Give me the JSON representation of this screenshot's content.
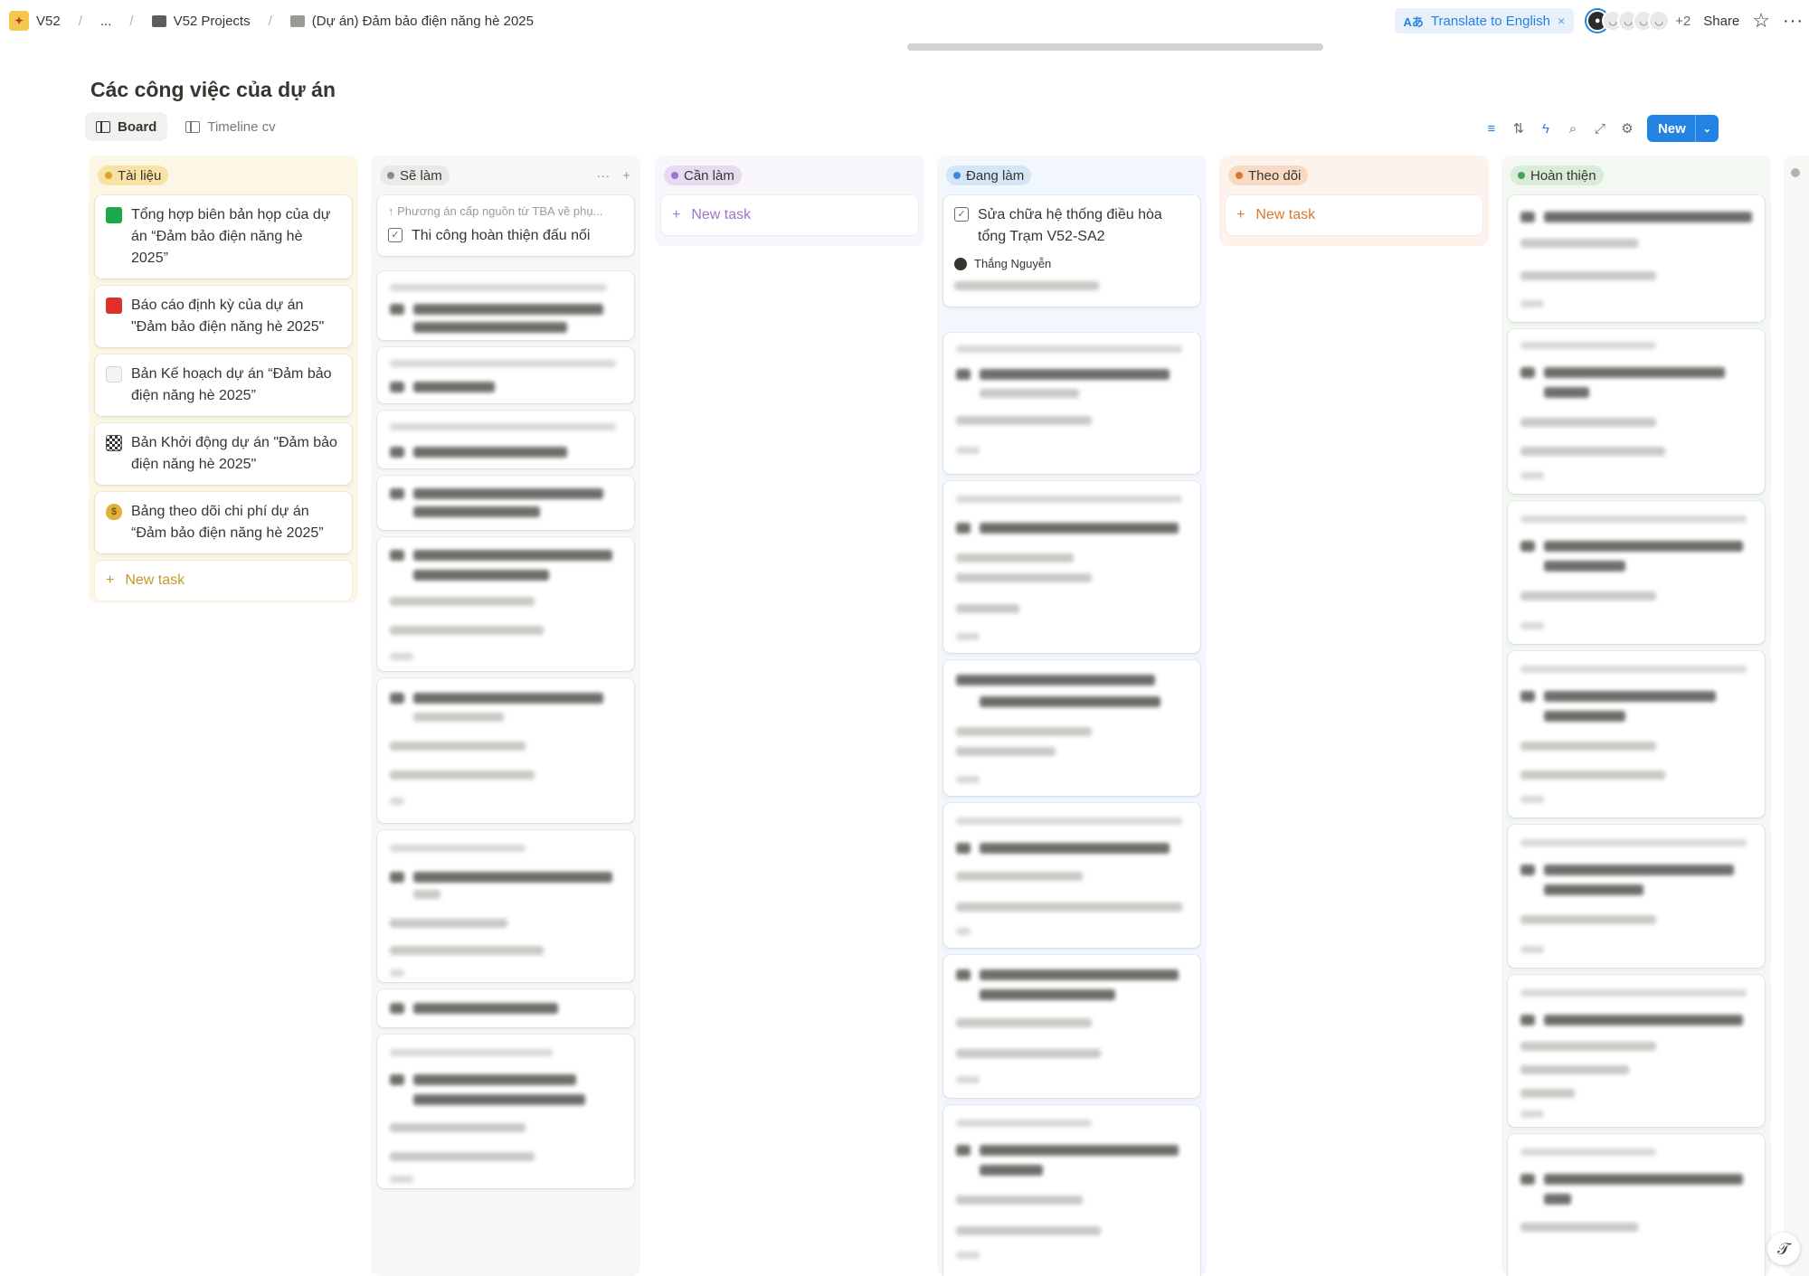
{
  "breadcrumb": {
    "workspace": "V52",
    "ellipsis": "...",
    "projects": "V52 Projects",
    "page": "(Dự án) Đảm bảo điện năng hè 2025"
  },
  "topbar": {
    "translate_label": "Translate to English",
    "translate_close": "×",
    "more_people": "+2",
    "share": "Share",
    "star": "☆",
    "more": "···"
  },
  "page": {
    "title": "Các công việc của dự án"
  },
  "tabs": [
    {
      "label": "Board"
    },
    {
      "label": "Timeline cv"
    }
  ],
  "toolbar": {
    "new_label": "New",
    "new_caret": "⌄"
  },
  "columns": {
    "tai_lieu": {
      "label": "Tài liệu",
      "color": "#fbf6e6",
      "pill_bg": "#f8e2a6",
      "dot": "#d6a52a",
      "cards": [
        {
          "icon": "green-square-icon",
          "title": "Tổng hợp biên bản họp của dự án “Đảm bảo điện năng hè 2025”"
        },
        {
          "icon": "red-square-icon",
          "title": "Báo cáo định kỳ của dự án \"Đảm bảo điện năng hè 2025\""
        },
        {
          "icon": "document-icon",
          "title": "Bản Kế hoạch dự án “Đảm bảo điện năng hè 2025”"
        },
        {
          "icon": "checkered-flag-icon",
          "title": "Bản Khởi động dự án \"Đảm bảo điện năng hè 2025\""
        },
        {
          "icon": "money-bag-icon",
          "title": "Bảng theo dõi chi phí dự án “Đảm bảo điện năng hè 2025”"
        }
      ],
      "new_task": "New task",
      "new_task_color": "#c29a2b"
    },
    "se_lam": {
      "label": "Sẽ làm",
      "color": "#f7f7f5",
      "pill_bg": "#e9e9e7",
      "dot": "#8d8c88",
      "first_card": {
        "parent": "↑ Phương án cấp nguồn từ TBA về phụ...",
        "title": "Thi công hoàn thiện đấu nối"
      }
    },
    "can_lam": {
      "label": "Cần làm",
      "color": "#f8f6fb",
      "pill_bg": "#e6dcf2",
      "dot": "#9d76c8",
      "new_task": "New task",
      "new_task_color": "#9d76c8"
    },
    "dang_lam": {
      "label": "Đang làm",
      "color": "#f1f7fc",
      "pill_bg": "#d3e5f6",
      "dot": "#3b8ad8",
      "first_card": {
        "title": "Sửa chữa hệ thống điều hòa tổng Trạm V52-SA2",
        "assignee": "Thắng Nguyễn"
      }
    },
    "theo_doi": {
      "label": "Theo dõi",
      "color": "#fdf3ec",
      "pill_bg": "#f7d9c4",
      "dot": "#e0762d",
      "new_task": "New task",
      "new_task_color": "#d9772f"
    },
    "hoan_thien": {
      "label": "Hoàn thiện",
      "color": "#f3f8f3",
      "pill_bg": "#d9ecd9",
      "dot": "#47a25a"
    }
  },
  "fab_icon": "𝒯"
}
